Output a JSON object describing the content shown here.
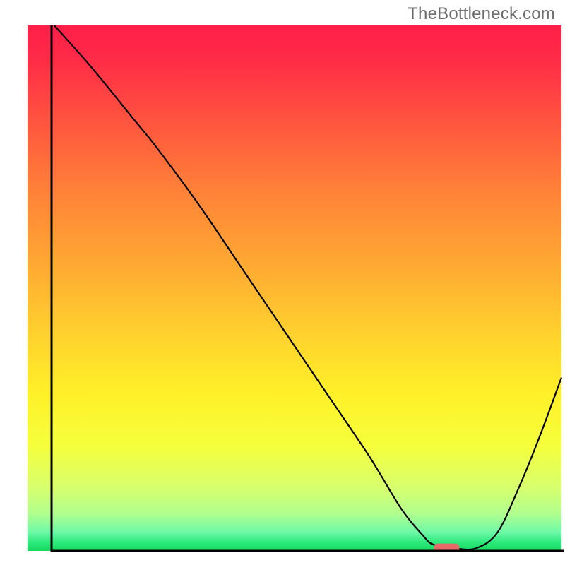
{
  "watermark": "TheBottleneck.com",
  "chart_data": {
    "type": "line",
    "title": "",
    "xlabel": "",
    "ylabel": "",
    "xlim": [
      0,
      100
    ],
    "ylim": [
      0,
      100
    ],
    "grid": false,
    "legend": false,
    "background_gradient_stops": [
      {
        "pos": 0.0,
        "color": "#ff1f48"
      },
      {
        "pos": 0.06,
        "color": "#ff2a47"
      },
      {
        "pos": 0.2,
        "color": "#ff5a3e"
      },
      {
        "pos": 0.32,
        "color": "#ff8338"
      },
      {
        "pos": 0.45,
        "color": "#ffa733"
      },
      {
        "pos": 0.58,
        "color": "#ffcf2e"
      },
      {
        "pos": 0.7,
        "color": "#fff028"
      },
      {
        "pos": 0.8,
        "color": "#f5ff3c"
      },
      {
        "pos": 0.88,
        "color": "#d7ff6e"
      },
      {
        "pos": 0.93,
        "color": "#b0ff8f"
      },
      {
        "pos": 0.965,
        "color": "#6cf8a6"
      },
      {
        "pos": 0.985,
        "color": "#2ae97a"
      },
      {
        "pos": 1.0,
        "color": "#18d95f"
      }
    ],
    "series": [
      {
        "name": "bottleneck-curve",
        "color": "#000000",
        "stroke_width": 2.2,
        "x": [
          5,
          12,
          20,
          24,
          32,
          40,
          48,
          56,
          64,
          70,
          74,
          76,
          80,
          84,
          88,
          92,
          96,
          100
        ],
        "y": [
          100,
          92,
          82,
          77,
          66,
          54,
          42,
          30,
          18,
          8,
          3,
          1.2,
          0.5,
          0.5,
          3.5,
          12,
          22,
          33
        ]
      }
    ],
    "marker": {
      "name": "optimal-zone",
      "shape": "rounded-rect",
      "color": "#e46a6a",
      "x_center": 78.5,
      "y_center": 0.6,
      "width": 4.8,
      "height": 1.6,
      "corner_radius": 0.8
    },
    "axes": {
      "color": "#000000",
      "stroke_width": 3,
      "left_x": 4.5,
      "bottom_y": 0,
      "right_x": 100
    }
  }
}
